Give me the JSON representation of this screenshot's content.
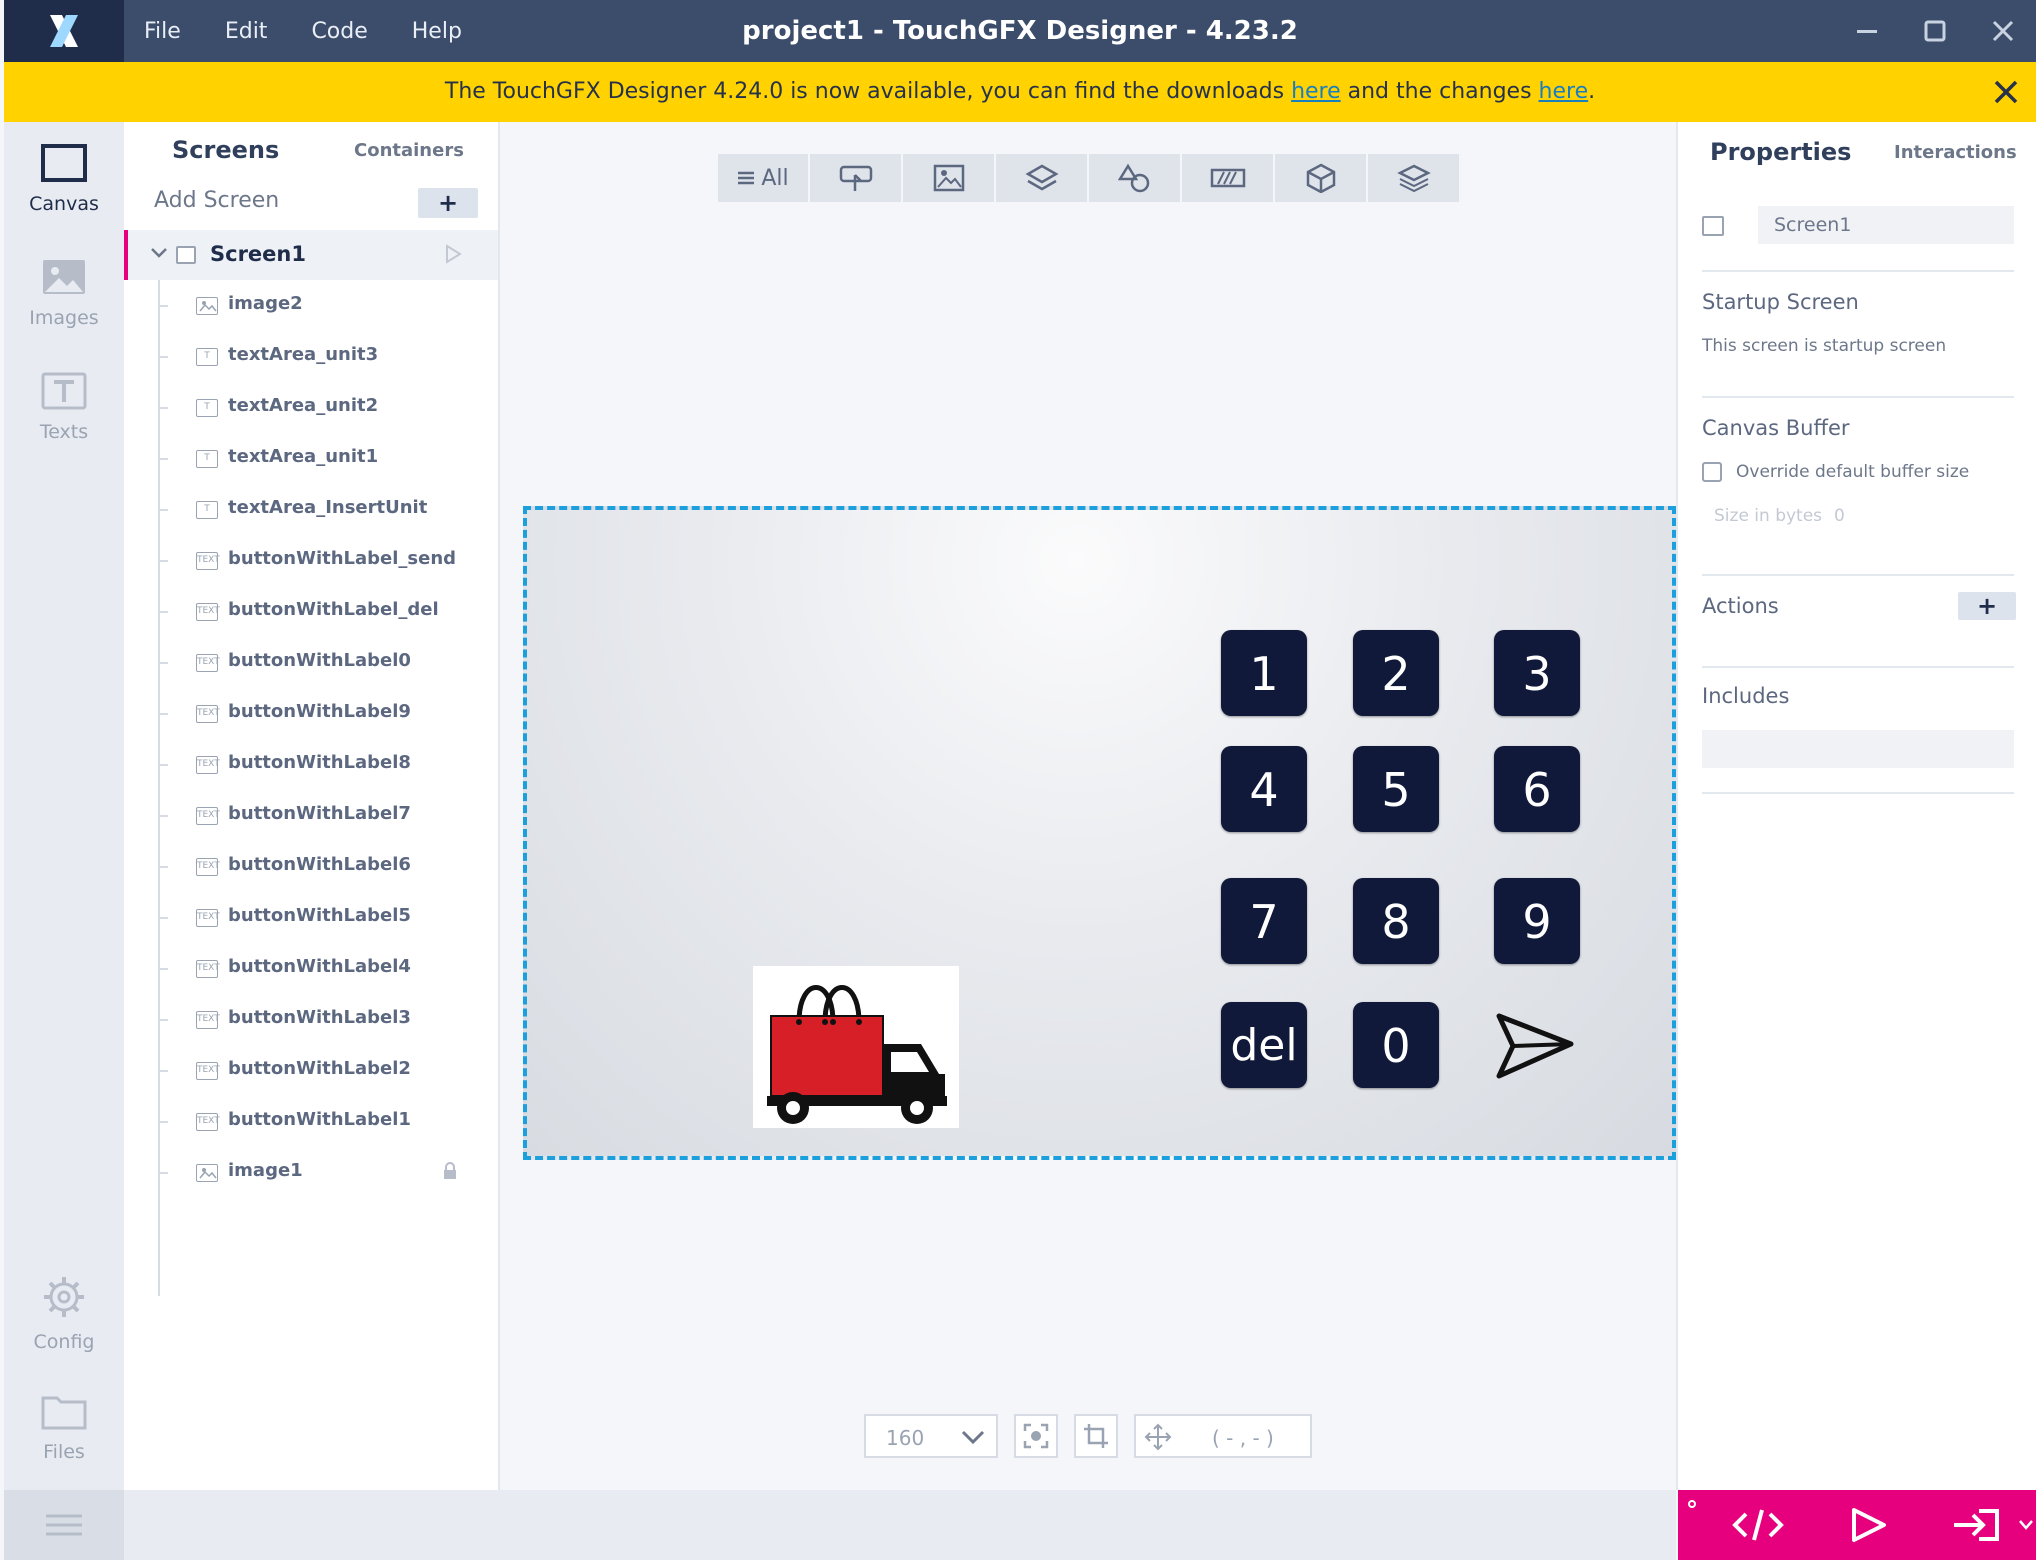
{
  "app": {
    "title": "project1 - TouchGFX Designer - 4.23.2",
    "menu": [
      "File",
      "Edit",
      "Code",
      "Help"
    ]
  },
  "banner": {
    "text_before": "The TouchGFX Designer 4.24.0 is now available, you can find the downloads ",
    "link1": "here",
    "text_middle": " and the changes ",
    "link2": "here",
    "text_after": "."
  },
  "rail": {
    "items": [
      {
        "label": "Canvas",
        "icon": "canvas-icon"
      },
      {
        "label": "Images",
        "icon": "image-icon"
      },
      {
        "label": "Texts",
        "icon": "text-icon"
      },
      {
        "label": "Config",
        "icon": "gear-icon"
      },
      {
        "label": "Files",
        "icon": "folder-icon"
      }
    ]
  },
  "screens_panel": {
    "tab_screens": "Screens",
    "tab_containers": "Containers",
    "add_screen": "Add Screen",
    "add_button": "+",
    "screen_name": "Screen1",
    "widgets": [
      {
        "name": "image2",
        "type": "image"
      },
      {
        "name": "textArea_unit3",
        "type": "text"
      },
      {
        "name": "textArea_unit2",
        "type": "text"
      },
      {
        "name": "textArea_unit1",
        "type": "text"
      },
      {
        "name": "textArea_InsertUnit",
        "type": "text"
      },
      {
        "name": "buttonWithLabel_send",
        "type": "button"
      },
      {
        "name": "buttonWithLabel_del",
        "type": "button"
      },
      {
        "name": "buttonWithLabel0",
        "type": "button"
      },
      {
        "name": "buttonWithLabel9",
        "type": "button"
      },
      {
        "name": "buttonWithLabel8",
        "type": "button"
      },
      {
        "name": "buttonWithLabel7",
        "type": "button"
      },
      {
        "name": "buttonWithLabel6",
        "type": "button"
      },
      {
        "name": "buttonWithLabel5",
        "type": "button"
      },
      {
        "name": "buttonWithLabel4",
        "type": "button"
      },
      {
        "name": "buttonWithLabel3",
        "type": "button"
      },
      {
        "name": "buttonWithLabel2",
        "type": "button"
      },
      {
        "name": "buttonWithLabel1",
        "type": "button"
      },
      {
        "name": "image1",
        "type": "image",
        "locked": true
      }
    ]
  },
  "canvas": {
    "filter_all": "All",
    "keypad": [
      "1",
      "2",
      "3",
      "4",
      "5",
      "6",
      "7",
      "8",
      "9",
      "del",
      "0"
    ],
    "zoom": "160",
    "coordinates": "( - , - )"
  },
  "properties": {
    "tab_properties": "Properties",
    "tab_interactions": "Interactions",
    "name_value": "Screen1",
    "startup_title": "Startup Screen",
    "startup_text": "This screen is startup screen",
    "buffer_title": "Canvas Buffer",
    "override_label": "Override default buffer size",
    "size_label": "Size in bytes",
    "size_value": "0",
    "actions_title": "Actions",
    "actions_add": "+",
    "includes_title": "Includes"
  },
  "colors": {
    "titlebar": "#3c4d6b",
    "banner": "#ffd200",
    "accent": "#e6007e",
    "key": "#10193a",
    "selection": "#1ca0dd"
  }
}
